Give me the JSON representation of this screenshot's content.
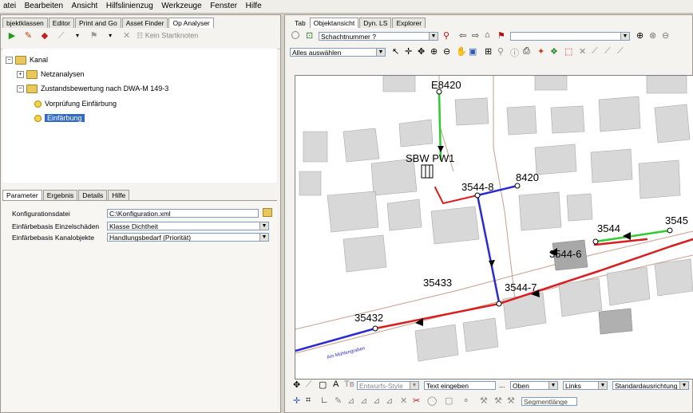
{
  "menu": [
    "atei",
    "Bearbeiten",
    "Ansicht",
    "Hilfslinienzug",
    "Werkzeuge",
    "Fenster",
    "Hilfe"
  ],
  "left_tabs": [
    "bjektklassen",
    "Editor",
    "Print and Go",
    "Asset Finder",
    "Op Analyser"
  ],
  "left_toolbar": {
    "start_node_label": "Kein Startknoten"
  },
  "tree": {
    "root": "Kanal",
    "netzanalysen": "Netzanalysen",
    "zustand": "Zustandsbewertung nach DWA-M 149-3",
    "vorpruefung": "Vorprüfung Einfärbung",
    "einfaerbung": "Einfärbung"
  },
  "param_tabs": [
    "Parameter",
    "Ergebnis",
    "Details",
    "Hilfe"
  ],
  "params": [
    {
      "label": "Konfigurationsdatei",
      "value": "C:\\Konfiguration.xml"
    },
    {
      "label": "Einfärbebasis Einzelschäden",
      "value": "Klasse Dichtheit"
    },
    {
      "label": "Einfärbebasis Kanalobjekte",
      "value": "Handlungsbedarf (Priorität)"
    }
  ],
  "right_tabs": [
    "Tab",
    "Objektansicht",
    "Dyn. LS",
    "Explorer"
  ],
  "right_toolbar": {
    "search_value": "Schachtnummer ?",
    "select_value": "Alles auswählen"
  },
  "map_labels": {
    "e8420": "E8420",
    "sbw": "SBW PW1",
    "n3544_8": "3544-8",
    "n8420": "8420",
    "n3544": "3544",
    "n3545": "3545",
    "n3544_6": "3544-6",
    "n35433": "35433",
    "n3544_7": "3544-7",
    "n35432": "35432",
    "street": "Am Mühlengraben"
  },
  "bottom_toolbar": {
    "style_value": "Entwurfs-Style",
    "text_input": "Text eingeben",
    "pos_value": "Oben",
    "align_value": "Links",
    "std_value": "Standardausrichtung",
    "segment_label": "Segmentlänge"
  },
  "colors": {
    "red_pipe": "#d81e1e",
    "blue_pipe": "#2a2ad0",
    "green_pipe": "#2ecc2e",
    "building": "#d8d8d8"
  }
}
